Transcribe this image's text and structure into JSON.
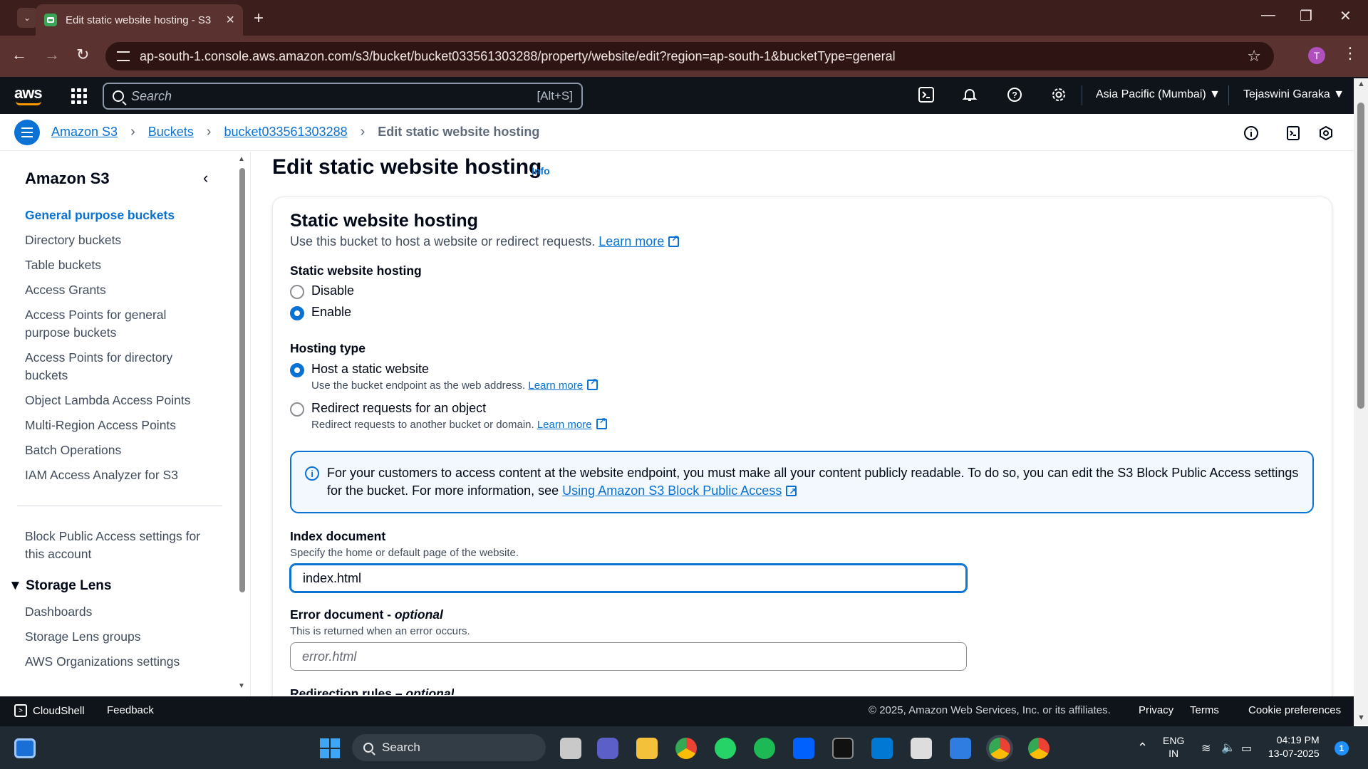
{
  "browser": {
    "tab_title": "Edit static website hosting - S3",
    "url": "ap-south-1.console.aws.amazon.com/s3/bucket/bucket033561303288/property/website/edit?region=ap-south-1&bucketType=general",
    "profile_initial": "T"
  },
  "aws_nav": {
    "logo": "aws",
    "search_placeholder": "Search",
    "search_shortcut": "[Alt+S]",
    "region": "Asia Pacific (Mumbai) ▼",
    "user": "Tejaswini Garaka ▼"
  },
  "breadcrumb": {
    "items": [
      "Amazon S3",
      "Buckets",
      "bucket033561303288"
    ],
    "current": "Edit static website hosting"
  },
  "sidebar": {
    "title": "Amazon S3",
    "items": [
      "General purpose buckets",
      "Directory buckets",
      "Table buckets",
      "Access Grants",
      "Access Points for general purpose buckets",
      "Access Points for directory buckets",
      "Object Lambda Access Points",
      "Multi-Region Access Points",
      "Batch Operations",
      "IAM Access Analyzer for S3"
    ],
    "block_public": "Block Public Access settings for this account",
    "section": "Storage Lens",
    "section_items": [
      "Dashboards",
      "Storage Lens groups",
      "AWS Organizations settings"
    ]
  },
  "main": {
    "page_title": "Edit static website hosting",
    "info_link": "Info",
    "panel_title": "Static website hosting",
    "panel_desc": "Use this bucket to host a website or redirect requests.",
    "learn_more": "Learn more",
    "hosting_label": "Static website hosting",
    "hosting_options": [
      "Disable",
      "Enable"
    ],
    "hosting_selected": "Enable",
    "type_label": "Hosting type",
    "type_options": [
      {
        "label": "Host a static website",
        "desc": "Use the bucket endpoint as the web address."
      },
      {
        "label": "Redirect requests for an object",
        "desc": "Redirect requests to another bucket or domain."
      }
    ],
    "type_selected": "Host a static website",
    "alert_text": "For your customers to access content at the website endpoint, you must make all your content publicly readable. To do so, you can edit the S3 Block Public Access settings for the bucket. For more information, see",
    "alert_link": "Using Amazon S3 Block Public Access",
    "index_label": "Index document",
    "index_hint": "Specify the home or default page of the website.",
    "index_value": "index.html",
    "error_label": "Error document - ",
    "error_optional": "optional",
    "error_hint": "This is returned when an error occurs.",
    "error_placeholder": "error.html",
    "redirect_label": "Redirection rules – ",
    "redirect_optional": "optional"
  },
  "footer": {
    "cloudshell": "CloudShell",
    "feedback": "Feedback",
    "copyright": "© 2025, Amazon Web Services, Inc. or its affiliates.",
    "privacy": "Privacy",
    "terms": "Terms",
    "cookies": "Cookie preferences"
  },
  "taskbar": {
    "search": "Search",
    "lang": "ENG",
    "lang_region": "IN",
    "time": "04:19 PM",
    "date": "13-07-2025",
    "notifications": "1"
  }
}
